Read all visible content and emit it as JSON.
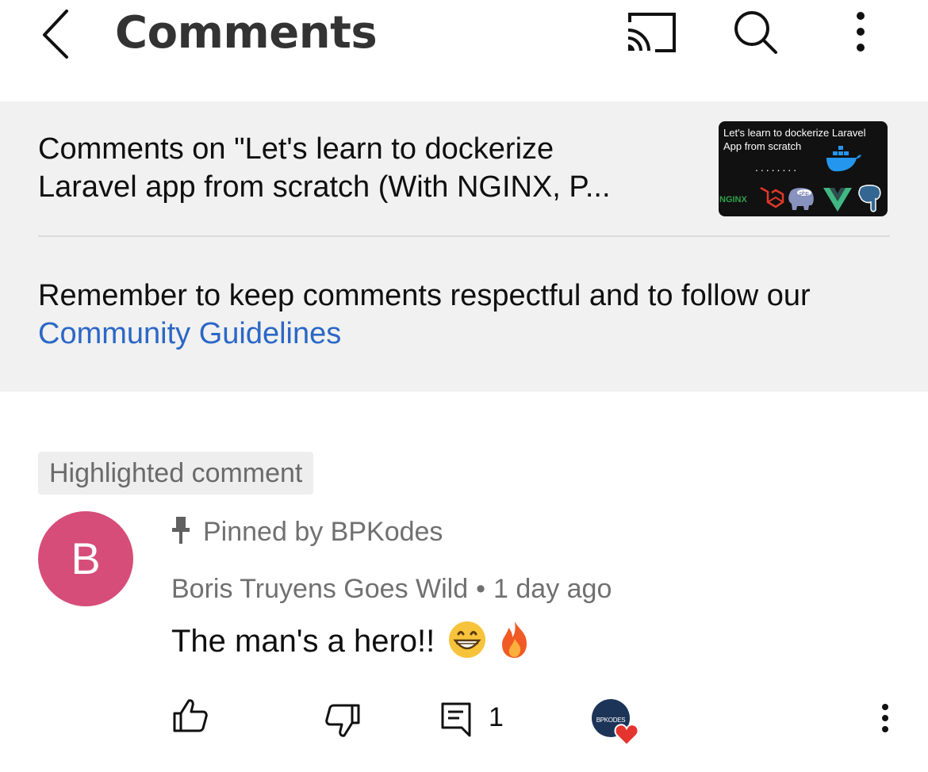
{
  "header": {
    "title": "Comments"
  },
  "video": {
    "title_line1": "Comments on \"Let's learn to dockerize",
    "title_line2": "Laravel app from scratch (With  NGINX, P...",
    "thumbnail_text": "Let's learn to dockerize Laravel App from scratch",
    "thumbnail_dots": "........",
    "thumbnail_logo_text": "NGINX"
  },
  "guidelines": {
    "text_before": "Remember to keep comments respectful and to follow our ",
    "link_text": "Community Guidelines"
  },
  "highlighted_label": "Highlighted comment",
  "comment": {
    "avatar_letter": "B",
    "avatar_color": "#d64d7a",
    "pinned_text": "Pinned by BPKodes",
    "author": "Boris Truyens Goes Wild",
    "separator": "•",
    "time": "1 day ago",
    "text": "The man's a hero!!",
    "emojis": [
      "grinning-face",
      "fire"
    ],
    "reply_count": "1",
    "creator_badge_text": "BPKODES"
  },
  "colors": {
    "link": "#2b67c6",
    "panel_bg": "#f1f1f1",
    "heart": "#e5342f",
    "secondary_text": "#707070"
  }
}
